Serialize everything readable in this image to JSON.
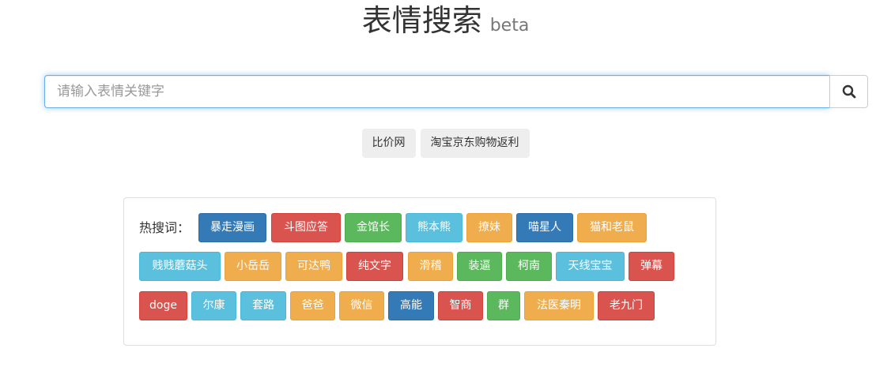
{
  "header": {
    "title": "表情搜索",
    "badge": "beta"
  },
  "search": {
    "placeholder": "请输入表情关键字",
    "value": ""
  },
  "links": [
    "比价网",
    "淘宝京东购物返利"
  ],
  "hot": {
    "label": "热搜词：",
    "tags": [
      {
        "text": "暴走漫画",
        "color": "#337ab7"
      },
      {
        "text": "斗图应答",
        "color": "#d9534f"
      },
      {
        "text": "金馆长",
        "color": "#5cb85c"
      },
      {
        "text": "熊本熊",
        "color": "#5bc0de"
      },
      {
        "text": "撩妹",
        "color": "#f0ad4e"
      },
      {
        "text": "喵星人",
        "color": "#337ab7"
      },
      {
        "text": "猫和老鼠",
        "color": "#f0ad4e"
      },
      {
        "text": "贱贱蘑菇头",
        "color": "#5bc0de"
      },
      {
        "text": "小岳岳",
        "color": "#f0ad4e"
      },
      {
        "text": "可达鸭",
        "color": "#f0ad4e"
      },
      {
        "text": "纯文字",
        "color": "#d9534f"
      },
      {
        "text": "滑稽",
        "color": "#f0ad4e"
      },
      {
        "text": "装逼",
        "color": "#5cb85c"
      },
      {
        "text": "柯南",
        "color": "#5cb85c"
      },
      {
        "text": "天线宝宝",
        "color": "#5bc0de"
      },
      {
        "text": "弹幕",
        "color": "#d9534f"
      },
      {
        "text": "doge",
        "color": "#d9534f"
      },
      {
        "text": "尔康",
        "color": "#5bc0de"
      },
      {
        "text": "套路",
        "color": "#5bc0de"
      },
      {
        "text": "爸爸",
        "color": "#f0ad4e"
      },
      {
        "text": "微信",
        "color": "#f0ad4e"
      },
      {
        "text": "高能",
        "color": "#337ab7"
      },
      {
        "text": "智商",
        "color": "#d9534f"
      },
      {
        "text": "群",
        "color": "#5cb85c"
      },
      {
        "text": "法医秦明",
        "color": "#f0ad4e"
      },
      {
        "text": "老九门",
        "color": "#d9534f"
      }
    ]
  },
  "icons": {
    "search_button": "search-icon"
  }
}
